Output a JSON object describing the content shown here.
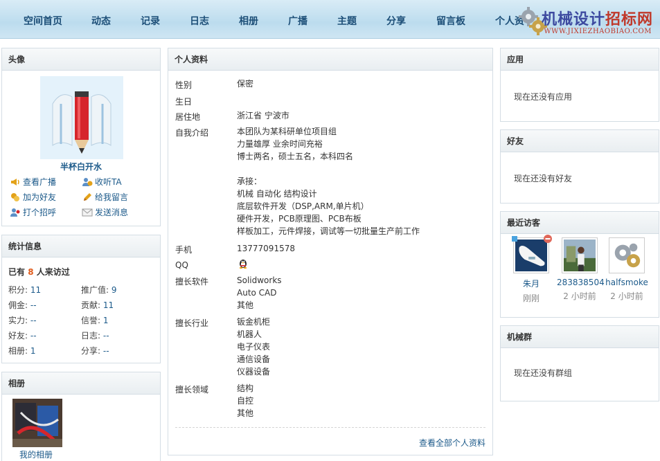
{
  "nav": {
    "items": [
      "空间首页",
      "动态",
      "记录",
      "日志",
      "相册",
      "广播",
      "主题",
      "分享",
      "留言板",
      "个人资"
    ],
    "brand_title_a": "机械设计",
    "brand_title_b": "招标网",
    "brand_url": "WWW.JIXIEZHAOBIAO.COM"
  },
  "avatar_box": {
    "title": "头像",
    "name": "半杯白开水",
    "actions": [
      {
        "label": "查看广播",
        "icon": "broadcast-icon"
      },
      {
        "label": "收听TA",
        "icon": "follow-icon"
      },
      {
        "label": "加为好友",
        "icon": "add-friend-icon"
      },
      {
        "label": "给我留言",
        "icon": "pencil-icon"
      },
      {
        "label": "打个招呼",
        "icon": "greet-icon"
      },
      {
        "label": "发送消息",
        "icon": "envelope-icon"
      }
    ]
  },
  "stats_box": {
    "title": "统计信息",
    "visits_prefix": "已有",
    "visits_count": "8",
    "visits_suffix": "人来访过",
    "items": [
      {
        "label": "积分:",
        "value": "11"
      },
      {
        "label": "推广值:",
        "value": "9"
      },
      {
        "label": "佣金:",
        "value": "--"
      },
      {
        "label": "贡献:",
        "value": "11"
      },
      {
        "label": "实力:",
        "value": "--"
      },
      {
        "label": "信誉:",
        "value": "1"
      },
      {
        "label": "好友:",
        "value": "--"
      },
      {
        "label": "日志:",
        "value": "--"
      },
      {
        "label": "相册:",
        "value": "1"
      },
      {
        "label": "分享:",
        "value": "--"
      }
    ]
  },
  "album_box": {
    "title": "相册",
    "album_name": "我的相册"
  },
  "profile": {
    "title": "个人资料",
    "gender_label": "性别",
    "gender": "保密",
    "birthday_label": "生日",
    "residence_label": "居住地",
    "residence": "浙江省 宁波市",
    "intro_label": "自我介绍",
    "intro_lines": [
      "本团队为某科研单位项目组",
      "力量雄厚 业余时间充裕",
      "博士两名，硕士五名，本科四名",
      "",
      "承接：",
      "机械 自动化 结构设计",
      "底层软件开发（DSP,ARM,单片机）",
      "硬件开发，PCB原理图、PCB布板",
      "样板加工，元件焊接，调试等一切批量生产前工作"
    ],
    "phone_label": "手机",
    "phone": "13777091578",
    "qq_label": "QQ",
    "software_label": "擅长软件",
    "software": [
      "Solidworks",
      "Auto CAD",
      "其他"
    ],
    "industry_label": "擅长行业",
    "industry": [
      "钣金机柜",
      "机器人",
      "电子仪表",
      "通信设备",
      "仪器设备"
    ],
    "field_label": "擅长领域",
    "field": [
      "结构",
      "自控",
      "其他"
    ],
    "more": "查看全部个人资料"
  },
  "apps_box": {
    "title": "应用",
    "empty": "现在还没有应用"
  },
  "friends_box": {
    "title": "好友",
    "empty": "现在还没有好友"
  },
  "visitors_box": {
    "title": "最近访客",
    "visitors": [
      {
        "name": "朱月",
        "time": "刚刚"
      },
      {
        "name": "283838504",
        "time": "2 小时前"
      },
      {
        "name": "halfsmoke",
        "time": "2 小时前"
      }
    ]
  },
  "group_box": {
    "title": "机械群",
    "empty": "现在还没有群组"
  }
}
